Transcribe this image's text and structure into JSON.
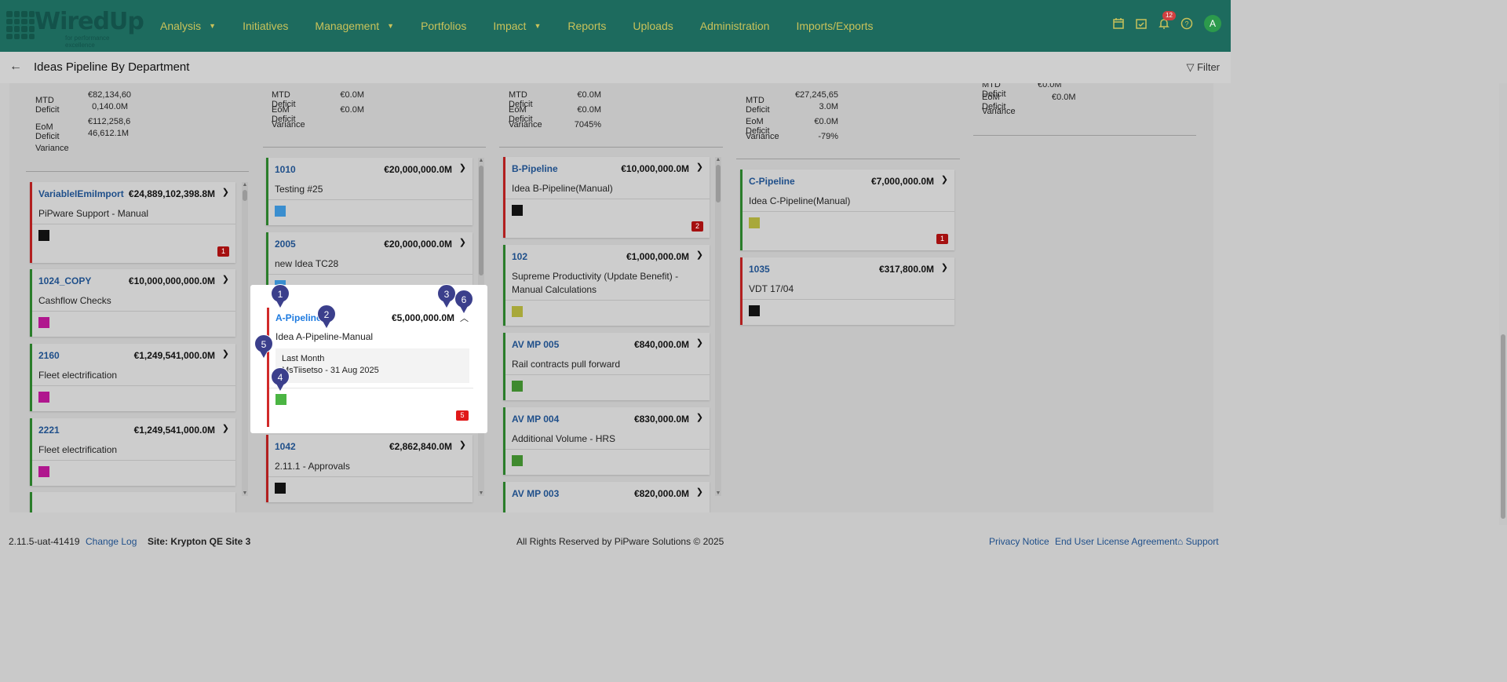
{
  "app": {
    "logo_text": "WiredUp",
    "logo_tag": "for performance excellence",
    "nav": [
      {
        "label": "Analysis",
        "has_caret": true
      },
      {
        "label": "Initiatives",
        "has_caret": false
      },
      {
        "label": "Management",
        "has_caret": true
      },
      {
        "label": "Portfolios",
        "has_caret": false
      },
      {
        "label": "Impact",
        "has_caret": true
      },
      {
        "label": "Reports",
        "has_caret": false
      },
      {
        "label": "Uploads",
        "has_caret": false
      },
      {
        "label": "Administration",
        "has_caret": false
      },
      {
        "label": "Imports/Exports",
        "has_caret": false
      }
    ],
    "notification_count": "12",
    "avatar_initial": "A"
  },
  "page": {
    "back_icon": "arrow-left-icon",
    "title": "Ideas Pipeline By Department",
    "filter_label": "Filter"
  },
  "columns": [
    {
      "metrics": [
        {
          "label": "MTD Deficit",
          "value_l1": "€82,134,60",
          "value_l2": "0,140.0M"
        },
        {
          "label": "EoM Deficit",
          "value_l1": "€112,258,6",
          "value_l2": "46,612.1M"
        },
        {
          "label": "Variance",
          "value_l1": "",
          "value_l2": ""
        }
      ],
      "cards": [
        {
          "id": "VariableIEmiImport",
          "amount": "€24,889,102,398.8M",
          "name": "PiPware Support - Manual",
          "color": "#111111",
          "count": "1",
          "border": "red"
        },
        {
          "id": "1024_COPY",
          "amount": "€10,000,000,000.0M",
          "name": "Cashflow Checks",
          "color": "#b0178e",
          "count": "",
          "border": "green"
        },
        {
          "id": "2160",
          "amount": "€1,249,541,000.0M",
          "name": "Fleet electrification",
          "color": "#b0178e",
          "count": "",
          "border": "green"
        },
        {
          "id": "2221",
          "amount": "€1,249,541,000.0M",
          "name": "Fleet electrification",
          "color": "#b0178e",
          "count": "",
          "border": "green"
        }
      ]
    },
    {
      "metrics": [
        {
          "label": "MTD Deficit",
          "value_l1": "€0.0M"
        },
        {
          "label": "EoM Deficit",
          "value_l1": "€0.0M"
        },
        {
          "label": "Variance",
          "value_l1": ""
        }
      ],
      "cards": [
        {
          "id": "1010",
          "amount": "€20,000,000.0M",
          "name": "Testing #25",
          "color": "#3a8ecf",
          "count": "",
          "border": "green"
        },
        {
          "id": "2005",
          "amount": "€20,000,000.0M",
          "name": "new Idea TC28",
          "color": "#3a8ecf",
          "count": "",
          "border": "green"
        },
        {
          "id": "1042",
          "amount": "€2,862,840.0M",
          "name": "2.11.1 - Approvals",
          "color": "#111111",
          "count": "",
          "border": "red"
        }
      ],
      "expanded_card": {
        "id": "A-Pipeline",
        "amount": "€5,000,000.0M",
        "name": "Idea A-Pipeline-Manual",
        "period": "Last Month",
        "owner_date": "MsTiisetso - 31 Aug 2025",
        "color": "#4bb543",
        "count": "5"
      }
    },
    {
      "metrics": [
        {
          "label": "MTD Deficit",
          "value_l1": "€0.0M"
        },
        {
          "label": "EoM Deficit",
          "value_l1": "€0.0M"
        },
        {
          "label": "Variance",
          "value_l1": "7045%"
        }
      ],
      "cards": [
        {
          "id": "B-Pipeline",
          "amount": "€10,000,000.0M",
          "name": "Idea B-Pipeline(Manual)",
          "color": "#111111",
          "count": "2",
          "border": "red"
        },
        {
          "id": "102",
          "amount": "€1,000,000.0M",
          "name": "Supreme Productivity (Update Benefit) - Manual Calculations",
          "color": "#a8a83a",
          "count": "",
          "border": "green"
        },
        {
          "id": "AV MP 005",
          "amount": "€840,000.0M",
          "name": "Rail contracts pull forward",
          "color": "#3f8a2e",
          "count": "",
          "border": "green"
        },
        {
          "id": "AV MP 004",
          "amount": "€830,000.0M",
          "name": "Additional Volume - HRS",
          "color": "#3f8a2e",
          "count": "",
          "border": "green"
        },
        {
          "id": "AV MP 003",
          "amount": "€820,000.0M",
          "name": "",
          "color": "",
          "count": "",
          "border": "green"
        }
      ]
    },
    {
      "metrics": [
        {
          "label": "MTD Deficit",
          "value_l1": "€27,245,65",
          "value_l2": "3.0M"
        },
        {
          "label": "EoM Deficit",
          "value_l1": "€0.0M"
        },
        {
          "label": "Variance",
          "value_l1": "-79%"
        }
      ],
      "cards": [
        {
          "id": "C-Pipeline",
          "amount": "€7,000,000.0M",
          "name": "Idea C-Pipeline(Manual)",
          "color": "#a8a83a",
          "count": "1",
          "border": "green"
        },
        {
          "id": "1035",
          "amount": "€317,800.0M",
          "name": "VDT 17/04",
          "color": "#111111",
          "count": "",
          "border": "red"
        }
      ]
    },
    {
      "metrics": [
        {
          "label": "MTD Deficit",
          "value_l1": "€0.0M"
        },
        {
          "label": "EoM Deficit",
          "value_l1": "€0.0M"
        },
        {
          "label": "Variance",
          "value_l1": ""
        }
      ],
      "cards": []
    }
  ],
  "markers": [
    "1",
    "2",
    "3",
    "4",
    "5",
    "6"
  ],
  "footer": {
    "version": "2.11.5-uat-41419",
    "changelog": "Change Log",
    "site": "Site: Krypton QE Site 3",
    "rights": "All Rights Reserved by PiPware Solutions © 2025",
    "privacy": "Privacy Notice",
    "eula": "End User License Agreement",
    "support": "Support"
  }
}
